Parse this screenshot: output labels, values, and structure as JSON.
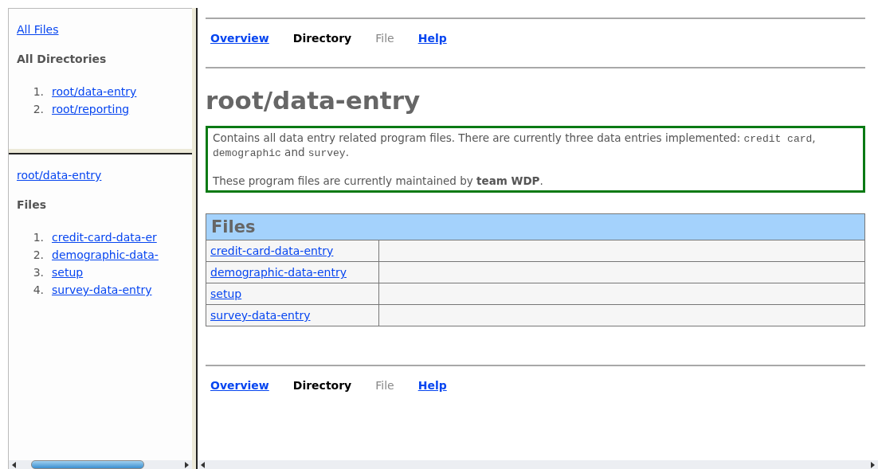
{
  "sidebar_top": {
    "link": "All Files",
    "heading": "All Directories",
    "items": [
      {
        "number": "1.",
        "label": "root/data-entry"
      },
      {
        "number": "2.",
        "label": "root/reporting"
      }
    ]
  },
  "sidebar_bottom": {
    "link": "root/data-entry",
    "heading": "Files",
    "items": [
      {
        "number": "1.",
        "label": "credit-card-data-er"
      },
      {
        "number": "2.",
        "label": "demographic-data-"
      },
      {
        "number": "3.",
        "label": "setup"
      },
      {
        "number": "4.",
        "label": "survey-data-entry"
      }
    ]
  },
  "nav_top": [
    {
      "label": "Overview",
      "kind": "link"
    },
    {
      "label": "Directory",
      "kind": "current"
    },
    {
      "label": "File",
      "kind": "disabled"
    },
    {
      "label": "Help",
      "kind": "link"
    }
  ],
  "title": "root/data-entry",
  "description": {
    "paragraph_1": [
      {
        "text": "Contains all data entry related program files. There are currently three data entries implemented: ",
        "kind": "plain"
      },
      {
        "text": "credit card",
        "kind": "code"
      },
      {
        "text": ", ",
        "kind": "plain"
      },
      {
        "text": "demographic",
        "kind": "code"
      },
      {
        "text": " and ",
        "kind": "plain"
      },
      {
        "text": "survey",
        "kind": "code"
      },
      {
        "text": ".",
        "kind": "plain"
      }
    ],
    "paragraph_2": "These program files are currently maintained by **team WDP**."
  },
  "files_table": {
    "heading": "Files",
    "rows": [
      "credit-card-data-entry",
      "demographic-data-entry",
      "setup",
      "survey-data-entry"
    ]
  },
  "nav_bottom": [
    {
      "label": "Overview",
      "kind": "link"
    },
    {
      "label": "Directory",
      "kind": "current"
    },
    {
      "label": "File",
      "kind": "disabled"
    },
    {
      "label": "Help",
      "kind": "link"
    }
  ]
}
